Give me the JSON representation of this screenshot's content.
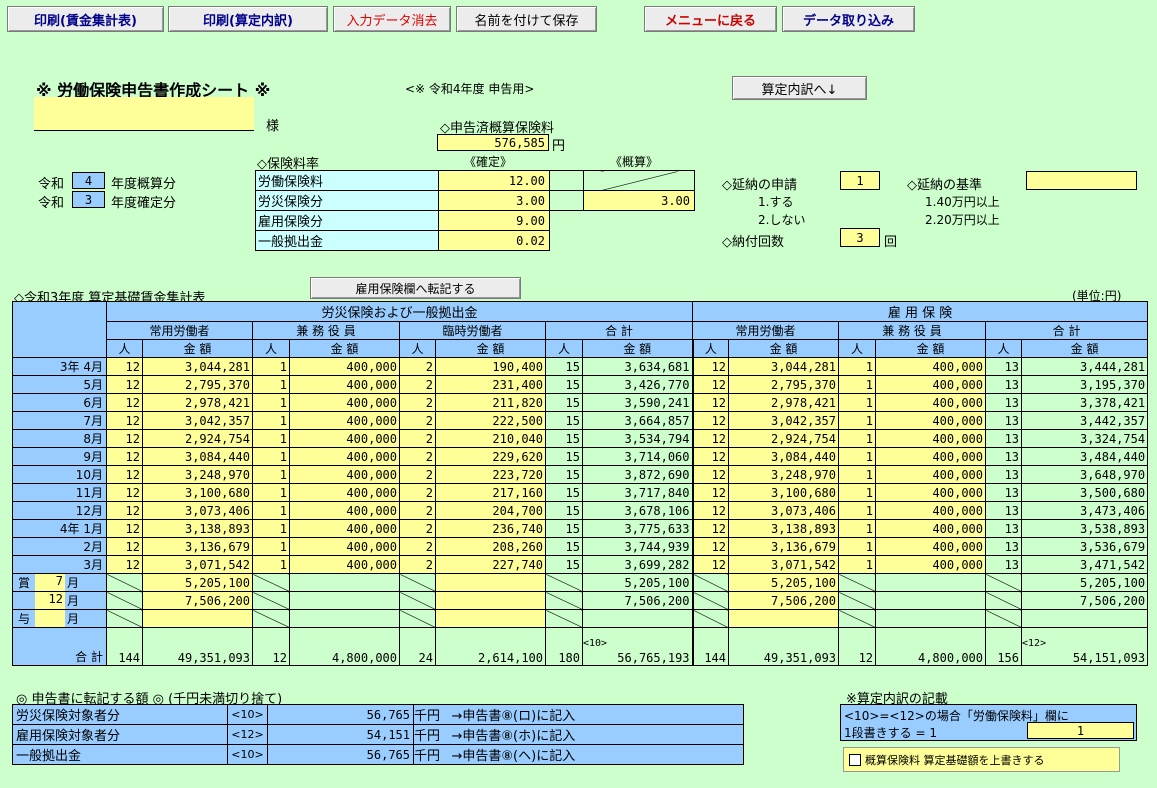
{
  "toolbar": {
    "print_wage": "印刷(賃金集計表)",
    "print_calc": "印刷(算定内訳)",
    "clear": "入力データ消去",
    "save_as": "名前を付けて保存",
    "menu": "メニューに戻る",
    "import": "データ取り込み"
  },
  "header": {
    "title": "※ 労働保険申告書作成シート ※",
    "subtitle": "<※ 令和4年度 申告用>",
    "calc_button": "算定内訳へ↓",
    "name_suffix": "様",
    "name_value": ""
  },
  "declared": {
    "label": "◇申告済概算保険料",
    "value": "576,585",
    "unit": "円"
  },
  "era": {
    "row1_prefix": "令和",
    "row1_value": "4",
    "row1_suffix": "年度概算分",
    "row2_prefix": "令和",
    "row2_value": "3",
    "row2_suffix": "年度確定分"
  },
  "rates": {
    "title": "◇保険料率",
    "col_fixed": "《確定》",
    "col_estimate": "《概算》",
    "rows": [
      {
        "label": "労働保険料",
        "fixed": "12.00",
        "estimate": ""
      },
      {
        "label": "労災保険分",
        "fixed": "3.00",
        "estimate": "3.00"
      },
      {
        "label": "雇用保険分",
        "fixed": "9.00",
        "estimate": ""
      },
      {
        "label": "一般拠出金",
        "fixed": "0.02",
        "estimate": ""
      }
    ]
  },
  "deferred": {
    "label": "◇延納の申請",
    "value": "1",
    "opt1": "1.する",
    "opt2": "2.しない",
    "basis_label": "◇延納の基準",
    "basis_value": "",
    "basis_opt1": "1.40万円以上",
    "basis_opt2": "2.20万円以上",
    "count_label": "◇納付回数",
    "count_value": "3",
    "count_unit": "回"
  },
  "section": {
    "title": "◇令和3年度 算定基礎賃金集計表",
    "transfer_button": "雇用保険欄へ転記する",
    "unit": "(単位:円)"
  },
  "table": {
    "group1": "労災保険および一般拠出金",
    "group2": "雇 用 保 険",
    "sub": [
      "常用労働者",
      "兼 務 役 員",
      "臨時労働者",
      "合  計",
      "常用労働者",
      "兼 務 役 員",
      "合  計"
    ],
    "h_people": "人",
    "h_amount": "金  額",
    "rows": [
      {
        "label": "3年 4月",
        "v": [
          "12",
          "3,044,281",
          "1",
          "400,000",
          "2",
          "190,400",
          "15",
          "3,634,681",
          "12",
          "3,044,281",
          "1",
          "400,000",
          "13",
          "3,444,281"
        ]
      },
      {
        "label": "5月",
        "v": [
          "12",
          "2,795,370",
          "1",
          "400,000",
          "2",
          "231,400",
          "15",
          "3,426,770",
          "12",
          "2,795,370",
          "1",
          "400,000",
          "13",
          "3,195,370"
        ]
      },
      {
        "label": "6月",
        "v": [
          "12",
          "2,978,421",
          "1",
          "400,000",
          "2",
          "211,820",
          "15",
          "3,590,241",
          "12",
          "2,978,421",
          "1",
          "400,000",
          "13",
          "3,378,421"
        ]
      },
      {
        "label": "7月",
        "v": [
          "12",
          "3,042,357",
          "1",
          "400,000",
          "2",
          "222,500",
          "15",
          "3,664,857",
          "12",
          "3,042,357",
          "1",
          "400,000",
          "13",
          "3,442,357"
        ]
      },
      {
        "label": "8月",
        "v": [
          "12",
          "2,924,754",
          "1",
          "400,000",
          "2",
          "210,040",
          "15",
          "3,534,794",
          "12",
          "2,924,754",
          "1",
          "400,000",
          "13",
          "3,324,754"
        ]
      },
      {
        "label": "9月",
        "v": [
          "12",
          "3,084,440",
          "1",
          "400,000",
          "2",
          "229,620",
          "15",
          "3,714,060",
          "12",
          "3,084,440",
          "1",
          "400,000",
          "13",
          "3,484,440"
        ]
      },
      {
        "label": "10月",
        "v": [
          "12",
          "3,248,970",
          "1",
          "400,000",
          "2",
          "223,720",
          "15",
          "3,872,690",
          "12",
          "3,248,970",
          "1",
          "400,000",
          "13",
          "3,648,970"
        ]
      },
      {
        "label": "11月",
        "v": [
          "12",
          "3,100,680",
          "1",
          "400,000",
          "2",
          "217,160",
          "15",
          "3,717,840",
          "12",
          "3,100,680",
          "1",
          "400,000",
          "13",
          "3,500,680"
        ]
      },
      {
        "label": "12月",
        "v": [
          "12",
          "3,073,406",
          "1",
          "400,000",
          "2",
          "204,700",
          "15",
          "3,678,106",
          "12",
          "3,073,406",
          "1",
          "400,000",
          "13",
          "3,473,406"
        ]
      },
      {
        "label": "4年 1月",
        "v": [
          "12",
          "3,138,893",
          "1",
          "400,000",
          "2",
          "236,740",
          "15",
          "3,775,633",
          "12",
          "3,138,893",
          "1",
          "400,000",
          "13",
          "3,538,893"
        ]
      },
      {
        "label": "2月",
        "v": [
          "12",
          "3,136,679",
          "1",
          "400,000",
          "2",
          "208,260",
          "15",
          "3,744,939",
          "12",
          "3,136,679",
          "1",
          "400,000",
          "13",
          "3,536,679"
        ]
      },
      {
        "label": "3月",
        "v": [
          "12",
          "3,071,542",
          "1",
          "400,000",
          "2",
          "227,740",
          "15",
          "3,699,282",
          "12",
          "3,071,542",
          "1",
          "400,000",
          "13",
          "3,471,542"
        ]
      }
    ],
    "bonus_label": "賞与",
    "bonus": [
      {
        "month": "7",
        "unit": "月",
        "amount": "5,205,100",
        "total": "5,205,100",
        "emp_amount": "5,205,100",
        "emp_total": "5,205,100"
      },
      {
        "month": "12",
        "unit": "月",
        "amount": "7,506,200",
        "total": "7,506,200",
        "emp_amount": "7,506,200",
        "emp_total": "7,506,200"
      },
      {
        "month": "",
        "unit": "月",
        "amount": "",
        "total": "",
        "emp_amount": "",
        "emp_total": ""
      }
    ],
    "total_label": "合  計",
    "total_tag1": "<10>",
    "total_tag2": "<12>",
    "totals": [
      "144",
      "49,351,093",
      "12",
      "4,800,000",
      "24",
      "2,614,100",
      "180",
      "56,765,193",
      "144",
      "49,351,093",
      "12",
      "4,800,000",
      "156",
      "54,151,093"
    ]
  },
  "transfer": {
    "title": "◎ 申告書に転記する額 ◎ (千円未満切り捨て)",
    "rows": [
      {
        "label": "労災保険対象者分",
        "tag": "<10>",
        "value": "56,765",
        "unit": "千円",
        "note": "→申告書⑧(ロ)に記入"
      },
      {
        "label": "雇用保険対象者分",
        "tag": "<12>",
        "value": "54,151",
        "unit": "千円",
        "note": "→申告書⑧(ホ)に記入"
      },
      {
        "label": "一般拠出金",
        "tag": "<10>",
        "value": "56,765",
        "unit": "千円",
        "note": "→申告書⑧(ヘ)に記入"
      }
    ]
  },
  "calc_note": {
    "title": "※算定内訳の記載",
    "line1": "<10>=<12>の場合「労働保険料」欄に",
    "line2": "1段書きする = 1",
    "value": "1",
    "checkbox_label": "概算保険料 算定基礎額を上書きする"
  }
}
